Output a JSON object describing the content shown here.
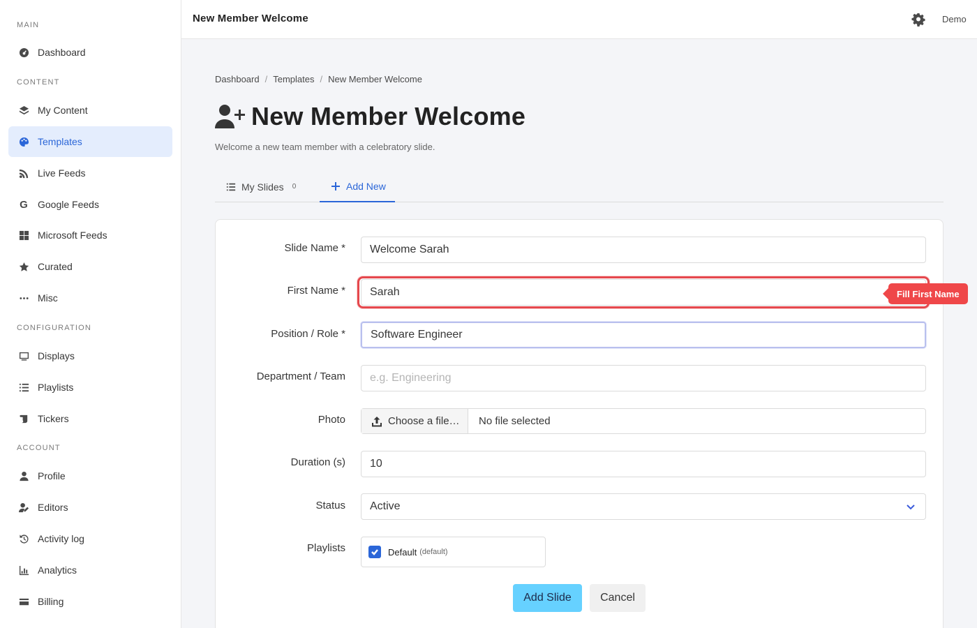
{
  "sidebar": {
    "sections": [
      {
        "label": "MAIN",
        "items": [
          {
            "label": "Dashboard",
            "icon": "gauge-icon"
          }
        ]
      },
      {
        "label": "CONTENT",
        "items": [
          {
            "label": "My Content",
            "icon": "layers-icon"
          },
          {
            "label": "Templates",
            "icon": "palette-icon",
            "active": true
          },
          {
            "label": "Live Feeds",
            "icon": "rss-icon"
          },
          {
            "label": "Google Feeds",
            "icon": "google-icon"
          },
          {
            "label": "Microsoft Feeds",
            "icon": "windows-icon"
          },
          {
            "label": "Curated",
            "icon": "star-icon"
          },
          {
            "label": "Misc",
            "icon": "ellipsis-icon"
          }
        ]
      },
      {
        "label": "CONFIGURATION",
        "items": [
          {
            "label": "Displays",
            "icon": "monitor-icon"
          },
          {
            "label": "Playlists",
            "icon": "list-icon"
          },
          {
            "label": "Tickers",
            "icon": "scroll-icon"
          }
        ]
      },
      {
        "label": "ACCOUNT",
        "items": [
          {
            "label": "Profile",
            "icon": "user-icon"
          },
          {
            "label": "Editors",
            "icon": "user-edit-icon"
          },
          {
            "label": "Activity log",
            "icon": "history-icon"
          },
          {
            "label": "Analytics",
            "icon": "chart-icon"
          },
          {
            "label": "Billing",
            "icon": "credit-card-icon"
          }
        ]
      }
    ]
  },
  "topbar": {
    "title": "New Member Welcome",
    "user": "Demo"
  },
  "breadcrumb": [
    "Dashboard",
    "Templates",
    "New Member Welcome"
  ],
  "page": {
    "title": "New Member Welcome",
    "subtitle": "Welcome a new team member with a celebratory slide."
  },
  "tabs": {
    "my_slides": {
      "label": "My Slides",
      "count": "0"
    },
    "add_new": {
      "label": "Add New"
    }
  },
  "form": {
    "slide_name": {
      "label": "Slide Name *",
      "value": "Welcome Sarah"
    },
    "first_name": {
      "label": "First Name *",
      "value": "Sarah"
    },
    "position": {
      "label": "Position / Role *",
      "value": "Software Engineer"
    },
    "department": {
      "label": "Department / Team",
      "placeholder": "e.g. Engineering"
    },
    "photo": {
      "label": "Photo",
      "button": "Choose a file…",
      "file": "No file selected"
    },
    "duration": {
      "label": "Duration (s)",
      "value": "10"
    },
    "status": {
      "label": "Status",
      "value": "Active"
    },
    "playlists": {
      "label": "Playlists",
      "name": "Default",
      "tag": "(default)",
      "checked": true
    }
  },
  "hint": {
    "text": "Fill First Name",
    "color": "#ef4749"
  },
  "actions": {
    "submit": "Add Slide",
    "cancel": "Cancel"
  },
  "colors": {
    "accent": "#2b66d8",
    "primary_button": "#66d1ff",
    "highlight": "#e5484d"
  }
}
